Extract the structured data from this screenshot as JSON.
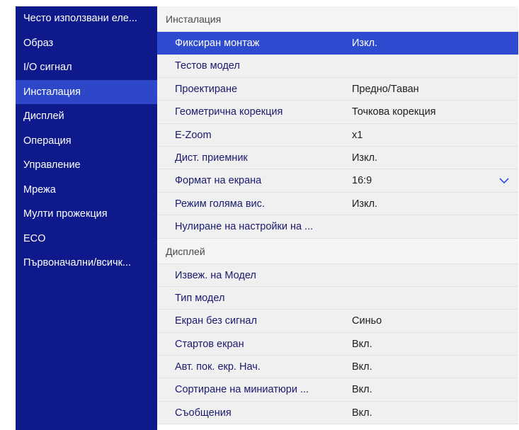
{
  "sidebar": {
    "items": [
      {
        "label": "Често използвани еле..."
      },
      {
        "label": "Образ"
      },
      {
        "label": "I/O сигнал"
      },
      {
        "label": "Инсталация"
      },
      {
        "label": "Дисплей"
      },
      {
        "label": "Операция"
      },
      {
        "label": "Управление"
      },
      {
        "label": "Мрежа"
      },
      {
        "label": "Мулти прожекция"
      },
      {
        "label": "ECO"
      },
      {
        "label": "Първоначални/всичк..."
      }
    ],
    "active_index": 3
  },
  "installation": {
    "header": "Инсталация",
    "rows": [
      {
        "label": "Фиксиран монтаж",
        "value": "Изкл."
      },
      {
        "label": "Тестов модел",
        "value": ""
      },
      {
        "label": "Проектиране",
        "value": "Предно/Таван"
      },
      {
        "label": "Геометрична корекция",
        "value": "Точкова корекция"
      },
      {
        "label": "E-Zoom",
        "value": "x1"
      },
      {
        "label": "Дист. приемник",
        "value": "Изкл."
      },
      {
        "label": "Формат на екрана",
        "value": "16:9"
      },
      {
        "label": "Режим голяма вис.",
        "value": "Изкл."
      },
      {
        "label": "Нулиране на настройки на ...",
        "value": ""
      }
    ]
  },
  "display": {
    "header": "Дисплей",
    "rows": [
      {
        "label": "Извеж. на Модел",
        "value": ""
      },
      {
        "label": "Тип модел",
        "value": ""
      },
      {
        "label": "Екран без сигнал",
        "value": "Синьо"
      },
      {
        "label": "Стартов екран",
        "value": "Вкл."
      },
      {
        "label": "Авт. пок. екр. Нач.",
        "value": "Вкл."
      },
      {
        "label": "Сортиране на миниатюри ...",
        "value": "Вкл."
      },
      {
        "label": "Съобщения",
        "value": "Вкл."
      }
    ]
  },
  "colors": {
    "sidebar_bg": "#0e1a8c",
    "sidebar_active": "#2e47c8",
    "row_selected": "#2f4bd0",
    "row_bg": "#f0f0f0"
  },
  "icons": {
    "dropdown": "chevron-down-icon"
  }
}
